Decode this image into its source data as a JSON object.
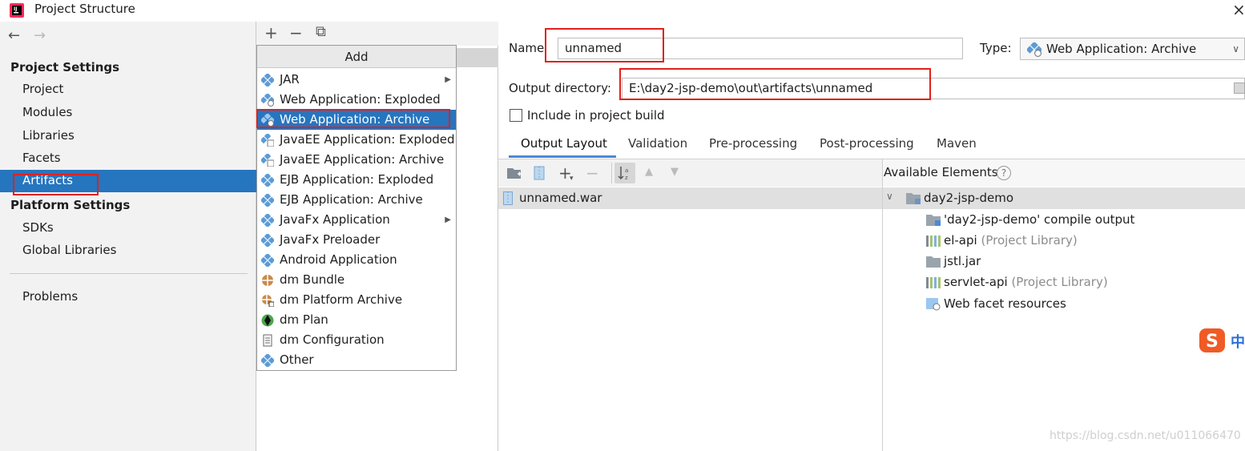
{
  "window": {
    "title": "Project Structure",
    "close": "×"
  },
  "nav": {
    "back": "←",
    "forward": "→"
  },
  "left": {
    "project_settings": "Project Settings",
    "project_items": [
      "Project",
      "Modules",
      "Libraries",
      "Facets",
      "Artifacts"
    ],
    "platform_settings": "Platform Settings",
    "platform_items": [
      "SDKs",
      "Global Libraries"
    ],
    "problems": "Problems",
    "selected": "Artifacts"
  },
  "middle": {
    "toolbar": {
      "add": "+",
      "remove": "−",
      "copy": "⧉"
    },
    "menu_header": "Add",
    "menu_items": [
      "JAR",
      "Web Application: Exploded",
      "Web Application: Archive",
      "JavaEE Application: Exploded",
      "JavaEE Application: Archive",
      "EJB Application: Exploded",
      "EJB Application: Archive",
      "JavaFx Application",
      "JavaFx Preloader",
      "Android Application",
      "dm Bundle",
      "dm Platform Archive",
      "dm Plan",
      "dm Configuration",
      "Other"
    ],
    "selected_item": "Web Application: Archive"
  },
  "right": {
    "name_label": "Name",
    "name_value": "unnamed",
    "type_label": "Type:",
    "type_value": "Web Application: Archive",
    "output_label": "Output directory:",
    "output_value": "E:\\day2-jsp-demo\\out\\artifacts\\unnamed",
    "include_label": "Include in project build",
    "include_checked": false,
    "tabs": [
      "Output Layout",
      "Validation",
      "Pre-processing",
      "Post-processing",
      "Maven"
    ],
    "active_tab": "Output Layout",
    "layout_root": "unnamed.war",
    "available_header": "Available Elements",
    "help": "?",
    "tree": {
      "root": "day2-jsp-demo",
      "children": [
        {
          "label": "'day2-jsp-demo' compile output",
          "note": "",
          "icon": "folder-output-icon"
        },
        {
          "label": "el-api",
          "note": "(Project Library)",
          "icon": "library-icon"
        },
        {
          "label": "jstl.jar",
          "note": "",
          "icon": "folder-icon"
        },
        {
          "label": "servlet-api",
          "note": "(Project Library)",
          "icon": "library-icon"
        },
        {
          "label": "Web facet resources",
          "note": "",
          "icon": "web-resources-icon"
        }
      ]
    }
  },
  "watermark": "https://blog.csdn.net/u011066470",
  "ime": {
    "label": "中"
  },
  "colors": {
    "selection": "#2675bf",
    "highlight_box": "#e0211c",
    "tab_underline": "#4a8ad7"
  }
}
